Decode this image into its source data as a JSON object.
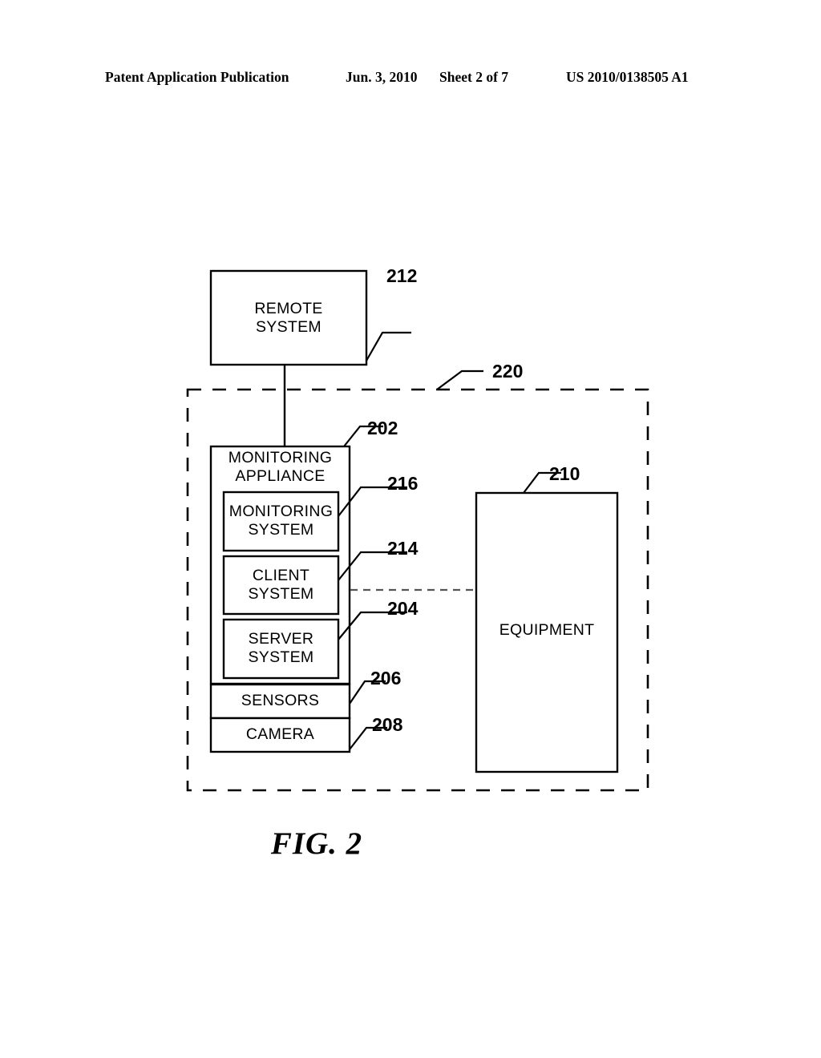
{
  "header": {
    "publication": "Patent Application Publication",
    "date": "Jun. 3, 2010",
    "sheet": "Sheet 2 of 7",
    "patent_number": "US 2010/0138505 A1"
  },
  "figure": {
    "caption": "FIG. 2",
    "boxes": {
      "remote_system": "REMOTE\nSYSTEM",
      "monitoring_appliance": "MONITORING\nAPPLIANCE",
      "monitoring_system": "MONITORING\nSYSTEM",
      "client_system": "CLIENT\nSYSTEM",
      "server_system": "SERVER\nSYSTEM",
      "sensors": "SENSORS",
      "camera": "CAMERA",
      "equipment": "EQUIPMENT"
    },
    "reference_numerals": {
      "remote_system": "212",
      "boundary": "220",
      "monitoring_appliance": "202",
      "monitoring_system": "216",
      "client_system": "214",
      "server_system": "204",
      "sensors": "206",
      "camera": "208",
      "equipment": "210"
    },
    "colors": {
      "line": "#000000",
      "background": "#ffffff"
    }
  }
}
